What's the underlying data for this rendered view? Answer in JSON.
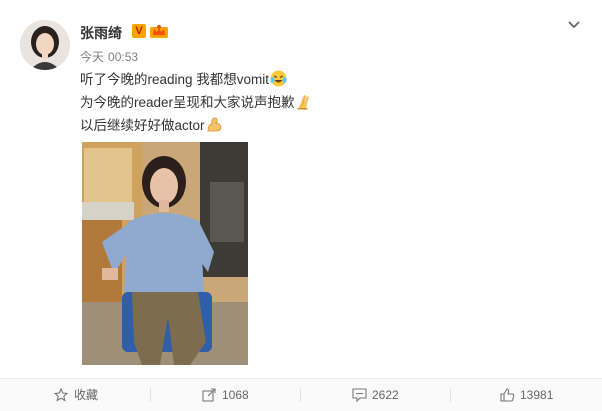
{
  "post": {
    "author": "张雨绮",
    "verified_badge": "V",
    "time_label": "今天",
    "time": "00:53",
    "lines": [
      "听了今晚的reading 我都想vomit",
      "为今晚的reader呈现和大家说声抱歉",
      "以后继续好好做actor"
    ],
    "line_emojis": [
      "crying-laughing-emoji",
      "praying-hands-emoji",
      "flexed-biceps-emoji"
    ]
  },
  "actions": {
    "favorite_label": "收藏",
    "repost_count": "1068",
    "comment_count": "2622",
    "like_count": "13981"
  },
  "icons": [
    "chevron-down-icon",
    "star-icon",
    "share-icon",
    "comment-icon",
    "thumbs-up-icon"
  ],
  "colors": {
    "badge_bg": "#f7a400",
    "badge_text": "#c01e00",
    "meta_gray": "#808080",
    "footer_bg": "#fafafa"
  }
}
